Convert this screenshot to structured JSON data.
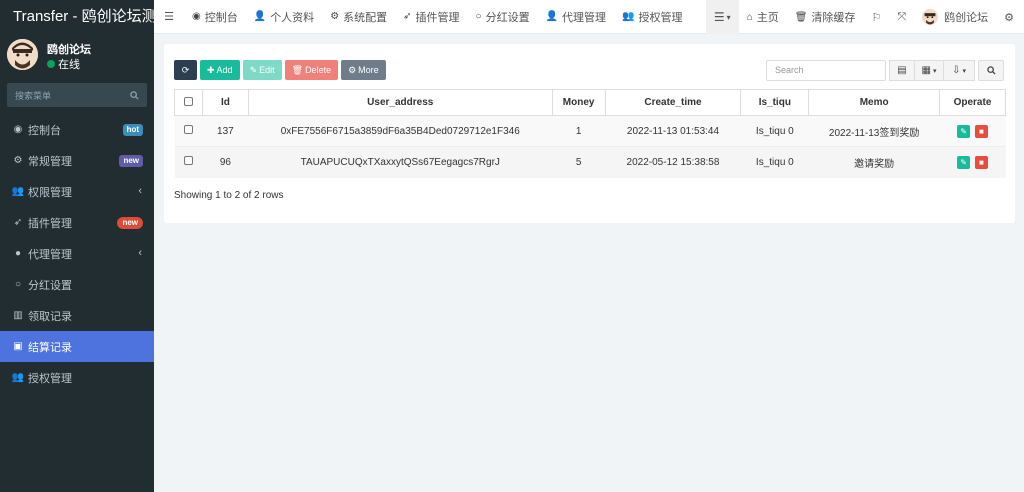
{
  "brand": "Transfer - 鸥创论坛测",
  "user": {
    "name": "鸥创论坛",
    "status": "在线"
  },
  "sidebar_search": {
    "placeholder": "搜索菜单"
  },
  "menu": [
    {
      "label": "控制台",
      "icon": "dashboard-icon",
      "badge": "hot"
    },
    {
      "label": "常规管理",
      "icon": "cogs-icon",
      "badge": "new"
    },
    {
      "label": "权限管理",
      "icon": "users-icon",
      "chevron": "‹"
    },
    {
      "label": "插件管理",
      "icon": "rocket-icon",
      "badge": "new"
    },
    {
      "label": "代理管理",
      "icon": "user-circle-icon",
      "chevron": "‹"
    },
    {
      "label": "分红设置",
      "icon": "circle-icon"
    },
    {
      "label": "领取记录",
      "icon": "list-icon"
    },
    {
      "label": "结算记录",
      "icon": "table-icon",
      "active": true
    },
    {
      "label": "授权管理",
      "icon": "users-icon"
    }
  ],
  "topnav": [
    {
      "label": "控制台",
      "icon": "dashboard-icon"
    },
    {
      "label": "个人资料",
      "icon": "user-icon"
    },
    {
      "label": "系统配置",
      "icon": "cog-icon"
    },
    {
      "label": "插件管理",
      "icon": "rocket-icon"
    },
    {
      "label": "分红设置",
      "icon": "circle-icon"
    },
    {
      "label": "代理管理",
      "icon": "user-icon"
    },
    {
      "label": "授权管理",
      "icon": "users-icon"
    }
  ],
  "topright": {
    "home": "主页",
    "clear_cache": "清除缓存",
    "username": "鸥创论坛"
  },
  "toolbar": {
    "add": "Add",
    "edit": "Edit",
    "delete": "Delete",
    "more": "More",
    "search_placeholder": "Search"
  },
  "table": {
    "columns": [
      "Id",
      "User_address",
      "Money",
      "Create_time",
      "Is_tiqu",
      "Memo",
      "Operate"
    ],
    "rows": [
      {
        "id": "137",
        "address": "0xFE7556F6715a3859dF6a35B4Ded0729712e1F346",
        "money": "1",
        "time": "2022-11-13 01:53:44",
        "tiqu": "Is_tiqu 0",
        "memo": "2022-11-13签到奖励"
      },
      {
        "id": "96",
        "address": "TAUAPUCUQxTXaxxytQSs67Eegagcs7RgrJ",
        "money": "5",
        "time": "2022-05-12 15:38:58",
        "tiqu": "Is_tiqu 0",
        "memo": "邀请奖励"
      }
    ]
  },
  "pagination_info": "Showing 1 to 2 of 2 rows",
  "colors": {
    "sidebar_bg": "#222d32",
    "active": "#4e73df",
    "add": "#18bc9c",
    "delete": "#e74c3c"
  }
}
